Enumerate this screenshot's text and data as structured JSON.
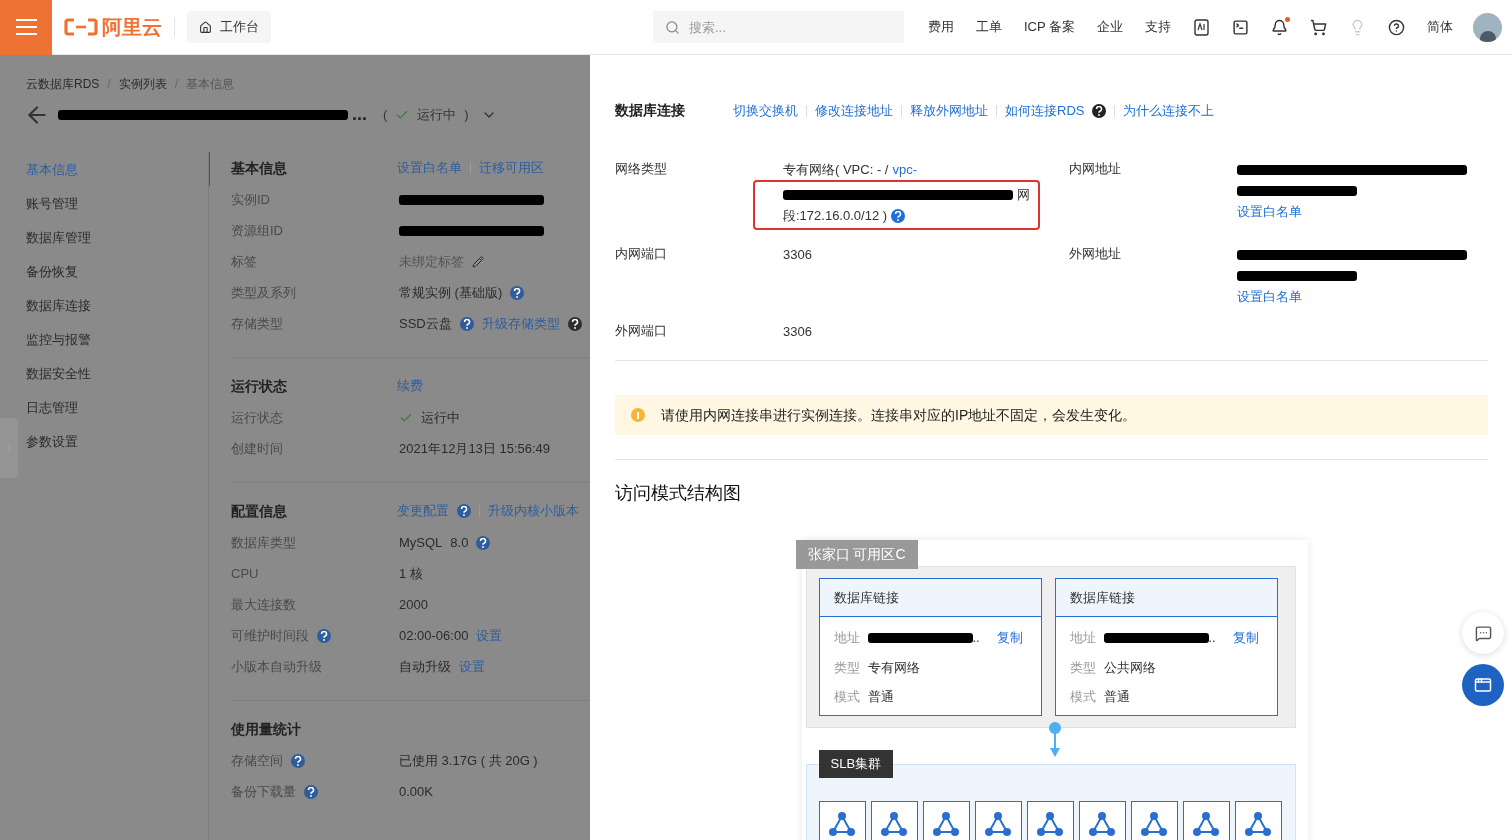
{
  "header": {
    "logo_text": "阿里云",
    "workbench": "工作台",
    "search": {
      "placeholder": "搜索..."
    },
    "nav_links": [
      "费用",
      "工单",
      "ICP 备案",
      "企业",
      "支持"
    ],
    "notification_unread": true,
    "language": "简体"
  },
  "breadcrumb": {
    "separator": "/",
    "items": [
      "云数据库RDS",
      "实例列表",
      "基本信息"
    ]
  },
  "instance": {
    "title_tail": "...",
    "status_open": "(",
    "status": "运行中",
    "status_close": ")"
  },
  "side_nav": [
    {
      "label": "基本信息",
      "selected": true
    },
    {
      "label": "账号管理",
      "selected": false
    },
    {
      "label": "数据库管理",
      "selected": false
    },
    {
      "label": "备份恢复",
      "selected": false
    },
    {
      "label": "数据库连接",
      "selected": false
    },
    {
      "label": "监控与报警",
      "selected": false
    },
    {
      "label": "数据安全性",
      "selected": false
    },
    {
      "label": "日志管理",
      "selected": false
    },
    {
      "label": "参数设置",
      "selected": false
    }
  ],
  "sections": [
    {
      "title": "基本信息",
      "actions": [
        {
          "kind": "link",
          "text": "设置白名单"
        },
        {
          "kind": "link",
          "text": "迁移可用区"
        }
      ],
      "rows": [
        {
          "label": "实例ID",
          "value": [
            {
              "kind": "redacted"
            }
          ]
        },
        {
          "label": "资源组ID",
          "value": [
            {
              "kind": "redacted"
            }
          ]
        },
        {
          "label": "标签",
          "value": [
            {
              "kind": "muted",
              "text": "未绑定标签"
            },
            {
              "kind": "edit"
            }
          ]
        },
        {
          "label": "类型及系列",
          "value": [
            {
              "kind": "text",
              "text": "常规实例 (基础版)"
            },
            {
              "kind": "help"
            }
          ]
        },
        {
          "label": "存储类型",
          "value": [
            {
              "kind": "text",
              "text": "SSD云盘"
            },
            {
              "kind": "help"
            },
            {
              "kind": "link",
              "text": "升级存储类型"
            },
            {
              "kind": "help_dark"
            }
          ]
        }
      ]
    },
    {
      "title": "运行状态",
      "actions": [
        {
          "kind": "link",
          "text": "续费"
        }
      ],
      "rows": [
        {
          "label": "运行状态",
          "value": [
            {
              "kind": "check"
            },
            {
              "kind": "text",
              "text": "运行中"
            }
          ]
        },
        {
          "label": "创建时间",
          "value": [
            {
              "kind": "text",
              "text": "2021年12月13日 15:56:49"
            }
          ]
        }
      ]
    },
    {
      "title": "配置信息",
      "actions": [
        {
          "kind": "link",
          "text": "变更配置"
        },
        {
          "kind": "help"
        },
        {
          "kind": "link",
          "text": "升级内核小版本"
        }
      ],
      "rows": [
        {
          "label": "数据库类型",
          "value": [
            {
              "kind": "text",
              "text": "MySQL"
            },
            {
              "kind": "text",
              "text": "8.0"
            },
            {
              "kind": "help"
            }
          ]
        },
        {
          "label": "CPU",
          "value": [
            {
              "kind": "text",
              "text": "1 核"
            }
          ]
        },
        {
          "label": "最大连接数",
          "value": [
            {
              "kind": "text",
              "text": "2000"
            }
          ]
        },
        {
          "label": "可维护时间段",
          "label_icons": [
            {
              "kind": "help"
            }
          ],
          "value": [
            {
              "kind": "text",
              "text": "02:00-06:00"
            },
            {
              "kind": "link",
              "text": "设置"
            }
          ]
        },
        {
          "label": "小版本自动升级",
          "value": [
            {
              "kind": "text",
              "text": "自动升级"
            },
            {
              "kind": "link",
              "text": "设置"
            }
          ]
        }
      ]
    },
    {
      "title": "使用量统计",
      "rows": [
        {
          "label": "存储空间",
          "label_icons": [
            {
              "kind": "help"
            }
          ],
          "value": [
            {
              "kind": "text",
              "text": "已使用 3.17G ( 共 20G )"
            }
          ]
        },
        {
          "label": "备份下载量",
          "label_icons": [
            {
              "kind": "help"
            }
          ],
          "value": [
            {
              "kind": "text",
              "text": "0.00K"
            }
          ]
        }
      ]
    }
  ],
  "connection": {
    "title": "数据库连接",
    "actions": [
      {
        "kind": "link",
        "text": "切换交换机"
      },
      {
        "kind": "link",
        "text": "修改连接地址"
      },
      {
        "kind": "link",
        "text": "释放外网地址"
      },
      {
        "kind": "link",
        "text": "如何连接RDS"
      },
      {
        "kind": "help_dark"
      },
      {
        "kind": "link",
        "text": "为什么连接不上"
      }
    ],
    "fields": [
      {
        "label": "网络类型",
        "lines": [
          {
            "highlighted": false,
            "parts": [
              {
                "kind": "text",
                "text": "专有网络( VPC: - /"
              },
              {
                "kind": "link",
                "text": "vpc-"
              }
            ]
          },
          {
            "highlighted": true,
            "parts": [
              {
                "kind": "redacted"
              },
              {
                "kind": "text",
                "text": "网"
              }
            ]
          },
          {
            "highlighted": true,
            "parts": [
              {
                "kind": "text",
                "text": "段:172.16.0.0/12 )"
              },
              {
                "kind": "help"
              }
            ]
          }
        ]
      },
      {
        "label": "内网地址",
        "lines": [
          {
            "highlighted": false,
            "parts": [
              {
                "kind": "redacted"
              }
            ]
          },
          {
            "highlighted": false,
            "parts": [
              {
                "kind": "redacted_short"
              }
            ]
          },
          {
            "highlighted": false,
            "parts": [
              {
                "kind": "link",
                "text": "设置白名单"
              }
            ]
          }
        ]
      },
      {
        "label": "内网端口",
        "lines": [
          {
            "highlighted": false,
            "parts": [
              {
                "kind": "text",
                "text": "3306"
              }
            ]
          }
        ]
      },
      {
        "label": "外网地址",
        "lines": [
          {
            "highlighted": false,
            "parts": [
              {
                "kind": "redacted"
              }
            ]
          },
          {
            "highlighted": false,
            "parts": [
              {
                "kind": "redacted_short"
              }
            ]
          },
          {
            "highlighted": false,
            "parts": [
              {
                "kind": "link",
                "text": "设置白名单"
              }
            ]
          }
        ]
      },
      {
        "label": "外网端口",
        "lines": [
          {
            "highlighted": false,
            "parts": [
              {
                "kind": "text",
                "text": "3306"
              }
            ]
          }
        ]
      }
    ]
  },
  "alert": {
    "text": "请使用内网连接串进行实例连接。连接串对应的IP地址不固定，会发生变化。"
  },
  "diagram": {
    "title": "访问模式结构图",
    "zone": "张家口 可用区C",
    "cards": [
      {
        "title": "数据库链接",
        "address_label": "地址",
        "address_tail": "..",
        "copy": "复制",
        "type_label": "类型",
        "type": "专有网络",
        "mode_label": "模式",
        "mode": "普通"
      },
      {
        "title": "数据库链接",
        "address_label": "地址",
        "address_tail": "..",
        "copy": "复制",
        "type_label": "类型",
        "type": "公共网络",
        "mode_label": "模式",
        "mode": "普通"
      }
    ],
    "cluster": "SLB集群",
    "nodes": [
      {
        "kind": "node"
      },
      {
        "kind": "node"
      },
      {
        "kind": "node"
      },
      {
        "kind": "node"
      },
      {
        "kind": "node"
      },
      {
        "kind": "node"
      },
      {
        "kind": "node"
      },
      {
        "kind": "node"
      },
      {
        "kind": "node"
      }
    ]
  }
}
